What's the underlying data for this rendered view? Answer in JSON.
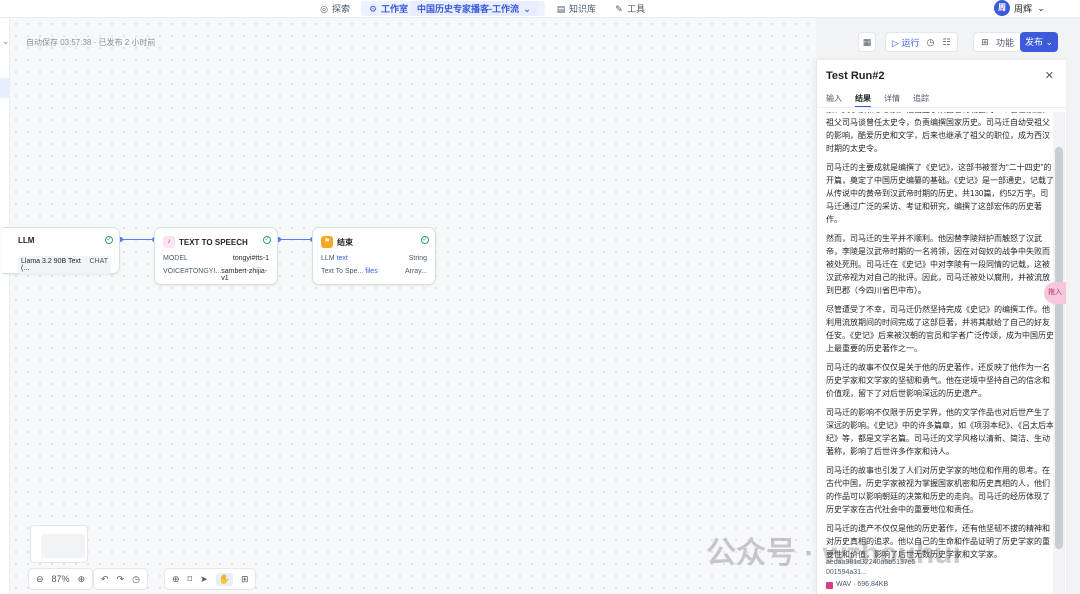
{
  "topnav": {
    "explore": "探索",
    "workspace": "工作室",
    "workflow": "中国历史专家播客-工作流",
    "knowledge": "知识库",
    "tools": "工具"
  },
  "user": {
    "avatar_text": "周",
    "name": "周辉"
  },
  "status": {
    "autosave": "自动保存 03:57:38 · 已发布 2 小时前"
  },
  "toolbar": {
    "run_label": "运行",
    "features_label": "功能",
    "publish_label": "发布"
  },
  "nodes": {
    "llm": {
      "title": "LLM",
      "model": "Llama 3.2 90B Text (...",
      "tag": "CHAT"
    },
    "tts": {
      "title": "TEXT TO SPEECH",
      "model_label": "MODEL",
      "model_value": "tongyi#tts-1",
      "voice_label": "VOICE#TONGYI...",
      "voice_value": "sambert-zhijia-v1"
    },
    "end": {
      "title": "结束",
      "row1_name": "LLM",
      "row1_var": "text",
      "row1_type": "String",
      "row2_name": "Text To Spe...",
      "row2_var": "files",
      "row2_type": "Array..."
    }
  },
  "bottombar": {
    "zoom": "87%"
  },
  "panel": {
    "title": "Test Run#2",
    "tabs": [
      "输入",
      "结果",
      "详情",
      "追踪"
    ],
    "active_tab": "结果",
    "paragraphs": [
      "家、文学家和思想家。他出生于陕西省韩城县的一个官宦家庭，祖父司马谈曾任太史令，负责编撰国家历史。司马迁自幼受祖父的影响，酷爱历史和文学，后来也继承了祖父的职位，成为西汉时期的太史令。",
      "司马迁的主要成就是编撰了《史记》，这部书被誉为“二十四史”的开篇，奠定了中国历史编纂的基础。《史记》是一部通史，记载了从传说中的黄帝到汉武帝时期的历史，共130篇，约52万字。司马迁通过广泛的采访、考证和研究，编撰了这部宏伟的历史著作。",
      "然而，司马迁的生平并不顺利。他因替李陵辩护而触怒了汉武帝，李陵是汉武帝时期的一名将领，因在对匈奴的战争中失败而被处死刑。司马迁在《史记》中对李陵有一段同情的记载，这被汉武帝视为对自己的批评。因此，司马迁被处以腐刑，并被流放到巴郡（今四川省巴中市）。",
      "尽管遭受了不幸，司马迁仍然坚持完成《史记》的编撰工作。他利用流放期间的时间完成了这部巨著，并将其献给了自己的好友任安。《史记》后来被汉朝的官员和学者广泛传颂，成为中国历史上最重要的历史著作之一。",
      "司马迁的故事不仅仅是关于他的历史著作，还反映了他作为一名历史学家和文学家的坚韧和勇气。他在逆境中坚持自己的信念和价值观，留下了对后世影响深远的历史遗产。",
      "司马迁的影响不仅限于历史学界，他的文学作品也对后世产生了深远的影响。《史记》中的许多篇章，如《项羽本纪》、《吕太后本纪》等，都是文学名篇。司马迁的文学风格以清新、简洁、生动著称，影响了后世许多作家和诗人。",
      "司马迁的故事也引发了人们对历史学家的地位和作用的思考。在古代中国，历史学家被视为掌握国家机密和历史真相的人，他们的作品可以影响朝廷的决策和历史的走向。司马迁的经历体现了历史学家在古代社会中的重要地位和责任。",
      "司马迁的遗产不仅仅是他的历史著作，还有他坚韧不拔的精神和对历史真相的追求。他以自己的生命和作品证明了历史学家的重要性和价值，影响了后世无数历史学家和文学家。"
    ],
    "file_id": "aedaa981d32240a5b5137e5001594a31...",
    "file_type": "WAV · 696.84KB"
  },
  "watermark": "公众号 · wzhouhui",
  "float_button": "拖入"
}
